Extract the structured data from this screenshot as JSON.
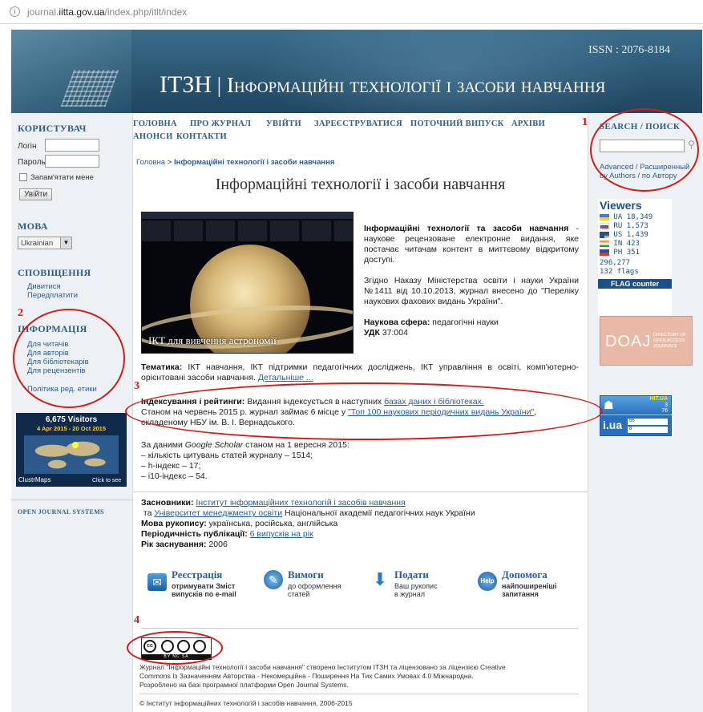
{
  "browser": {
    "url_prefix": "journal.",
    "url_domain": "iitta.gov.ua",
    "url_path": "/index.php/itlt/index"
  },
  "header": {
    "issn": "ISSN : 2076-8184",
    "abbr": "ІТЗН",
    "title": "Інформаційні технології і засоби навчання"
  },
  "annotations": [
    "1",
    "2",
    "3",
    "4"
  ],
  "left": {
    "user": {
      "heading": "КОРИСТУВАЧ",
      "login_label": "Логін",
      "password_label": "Пароль",
      "remember_label": "Запам'ятати мене",
      "login_button": "Увійти"
    },
    "lang": {
      "heading": "МОВА",
      "selected": "Ukrainian"
    },
    "notify": {
      "heading": "СПОВІЩЕННЯ",
      "items": [
        "Дивитися",
        "Передплатити"
      ]
    },
    "info": {
      "heading": "ІНФОРМАЦІЯ",
      "items": [
        "Для читачів",
        "Для авторів",
        "Для бібліотекарів",
        "Для рецензентів"
      ],
      "policy": "Політика ред. етики"
    },
    "clustr": {
      "visitors": "6,675 Visitors",
      "range": "4 Apr 2015 - 20 Oct 2015",
      "brand": "ClustrMaps",
      "click": "Click to see"
    },
    "ojs": "OPEN JOURNAL SYSTEMS"
  },
  "nav": {
    "row1": [
      "ГОЛОВНА",
      "ПРО ЖУРНАЛ",
      "УВІЙТИ",
      "ЗАРЕЄСТРУВАТИСЯ",
      "ПОТОЧНИЙ ВИПУСК",
      "АРХІВИ"
    ],
    "row2": [
      "АНОНСИ",
      "КОНТАКТИ"
    ]
  },
  "breadcrumb": {
    "home": "Головна",
    "sep": ">",
    "current": "Інформаційні технології і засоби навчання"
  },
  "page_title": "Інформаційні технології і засоби навчання",
  "image_caption": "ІКТ для вивчення астрономії",
  "intro": {
    "title": "Інформаційні технології та засоби навчання",
    "text": "- наукове рецензоване електронне видання, яке постачає читачам контент в миттєвому відкритому доступі.",
    "order": "Згідно Наказу Міністерства освіти і науки України №1411 від 10.10.2013, журнал внесено до \"Переліку наукових фахових видань України\".",
    "sphere_label": "Наукова сфера:",
    "sphere_value": "педагогічні науки",
    "udk_label": "УДК",
    "udk_value": "37:004"
  },
  "topics": {
    "label": "Тематика:",
    "text": "ІКТ навчання, ІКТ підтримки педагогічних досліджень, ІКТ управління в освіті, комп'ютерно-орієнтовані засоби навчання.",
    "more": "Детальніше ..."
  },
  "indexing": {
    "label": "Індексування і рейтинги:",
    "text1": "Видання індексується в наступних",
    "link1": "базах даних і бібліотеках.",
    "text2": "Станом на червень 2015 р. журнал займає 6 місце у",
    "link2": "\"Топ 100 наукових періодичних видань України\"",
    "text3": ", складеному НБУ ім. В. І. Вернадського."
  },
  "scholar": {
    "l1a": "За даними",
    "l1b": "Google Scholar",
    "l1c": "станом на 1 вересня 2015:",
    "lines": [
      "– кількість цитувань статей журналу – 1514;",
      "– h-індекс – 17;",
      "– i10-індекс – 54."
    ]
  },
  "founders": {
    "label": "Засновники:",
    "link1": "Інститут інформаційних технологій і засобів навчання",
    "and": "та",
    "link2": "Університет менеджменту освіти",
    "rest": "Національної академії педагогічних наук України"
  },
  "meta": {
    "lang_label": "Мова рукопису:",
    "lang_value": "українська, російська, англійська",
    "freq_label": "Періодичність публікації:",
    "freq_value": "6 випусків на рік",
    "year_label": "Рік заснування:",
    "year_value": "2006"
  },
  "features": [
    {
      "title": "Реєстрація",
      "sub1": "отримувати Зміст",
      "sub2": "випусків по e-mail"
    },
    {
      "title": "Вимоги",
      "sub1": "до оформлення",
      "sub2": "статей"
    },
    {
      "title": "Подати",
      "sub1": "Ваш рукопис",
      "sub2": "в журнал"
    },
    {
      "title": "Допомога",
      "sub1": "найпоширеніші",
      "sub2": "запитання"
    }
  ],
  "footer": {
    "cc_letters": "BY  NC  SA",
    "line1": "Журнал \"Інформаційні технології і засоби навчання\" створено Інститутом ІТЗН та ліцензовано за ліцензією Creative",
    "line2": "Commons Із Зазначенням Авторства - Некомерційна - Поширення На Тих Самих Умовах 4.0 Міжнародна.",
    "line3": "Розроблено на базі програмної платформи Open Journal Systems.",
    "copyright": "© Інститут інформаційних технологій і засобів навчання, 2006-2015"
  },
  "right": {
    "search": {
      "heading": "SEARCH / ПОИСК",
      "advanced": "Advanced / Расширенный",
      "by_authors": "by Authors / по Автору"
    },
    "viewers": {
      "heading": "Viewers",
      "rows": [
        {
          "cc": "UA",
          "n": "18,349"
        },
        {
          "cc": "RU",
          "n": "1,573"
        },
        {
          "cc": "US",
          "n": "1,439"
        },
        {
          "cc": "IN",
          "n": "423"
        },
        {
          "cc": "PH",
          "n": "351"
        }
      ],
      "total": "296,277",
      "flags": "132 flags",
      "brand": "FLAG counter"
    },
    "doaj": {
      "logo": "DOAJ",
      "sub": "DIRECTORY OF OPEN ACCESS JOURNALS"
    },
    "hitua": {
      "label": "HIT.UA",
      "n1": "3",
      "n2": "76"
    },
    "iua": {
      "logo": "i.ua",
      "n1": "66",
      "n2": "8"
    }
  }
}
